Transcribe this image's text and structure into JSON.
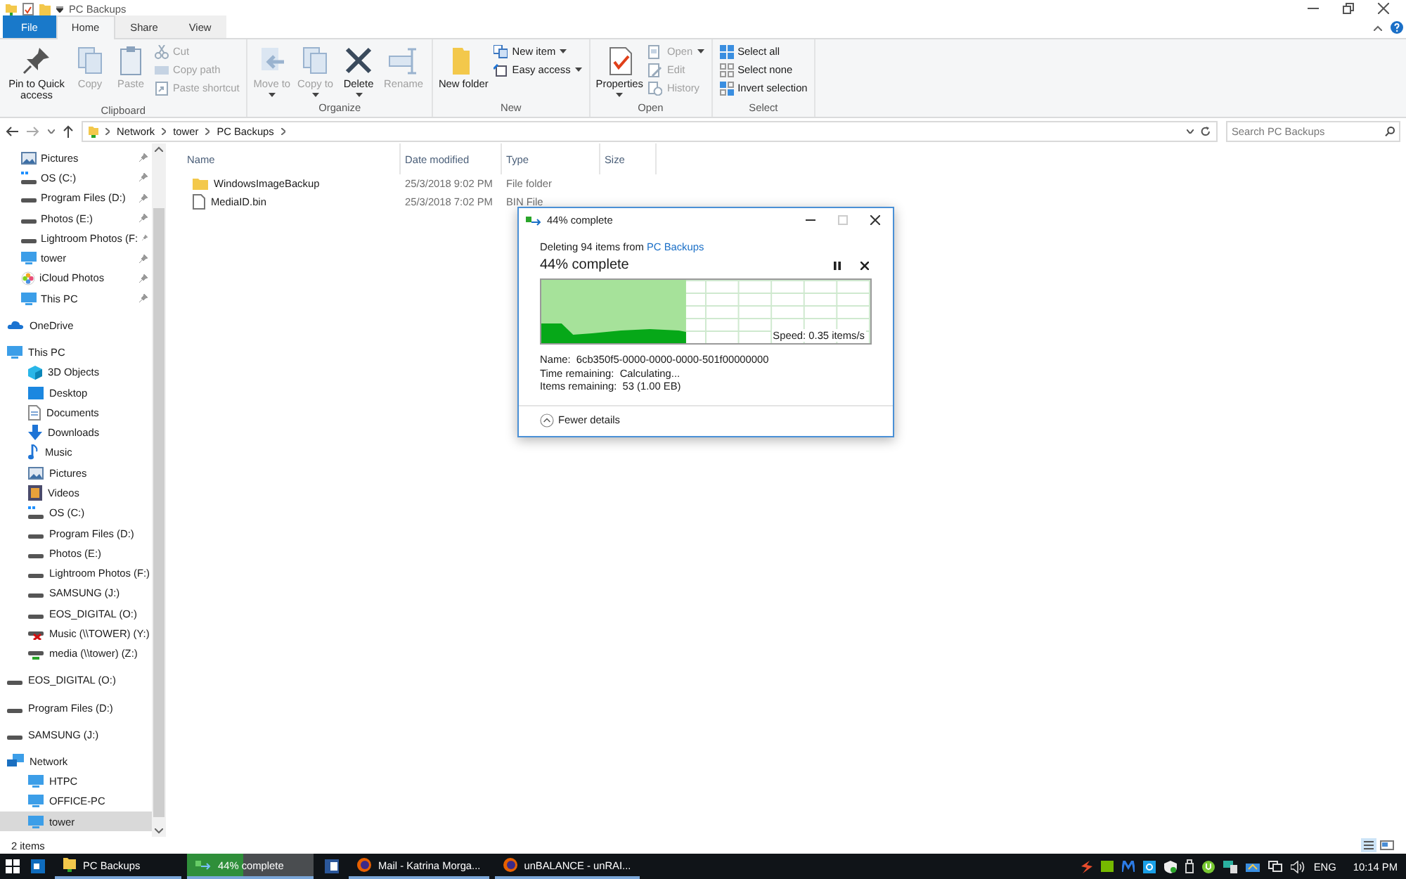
{
  "window": {
    "title": "PC Backups"
  },
  "ribbon_tabs": [
    {
      "label": "File",
      "kind": "file",
      "selected": false
    },
    {
      "label": "Home",
      "kind": "tab",
      "selected": true
    },
    {
      "label": "Share",
      "kind": "tab",
      "selected": false
    },
    {
      "label": "View",
      "kind": "tab",
      "selected": false
    }
  ],
  "ribbon_groups": [
    {
      "label": "Clipboard",
      "buttons": [
        {
          "label": "Pin to Quick access",
          "kind": "pin",
          "disabled": false,
          "dropdown": false
        },
        {
          "label": "Copy",
          "kind": "copy",
          "disabled": true,
          "dropdown": false
        },
        {
          "label": "Paste",
          "kind": "paste",
          "disabled": true,
          "dropdown": false
        },
        {
          "kind": "stack",
          "items": [
            {
              "label": "Cut",
              "kind": "cut",
              "disabled": true,
              "dropdown": false
            },
            {
              "label": "Copy path",
              "kind": "copy-path",
              "disabled": true,
              "dropdown": false
            },
            {
              "label": "Paste shortcut",
              "kind": "paste-shortcut",
              "disabled": true,
              "dropdown": false
            }
          ]
        }
      ]
    },
    {
      "label": "Organize",
      "buttons": [
        {
          "label": "Move to",
          "kind": "move",
          "disabled": true,
          "dropdown": true
        },
        {
          "label": "Copy to",
          "kind": "copyto",
          "disabled": true,
          "dropdown": true
        },
        {
          "label": "Delete",
          "kind": "delete",
          "disabled": false,
          "dropdown": true
        },
        {
          "label": "Rename",
          "kind": "rename",
          "disabled": true,
          "dropdown": false
        }
      ]
    },
    {
      "label": "New",
      "buttons": [
        {
          "label": "New folder",
          "kind": "new-folder",
          "disabled": false,
          "dropdown": false
        },
        {
          "kind": "stack",
          "items": [
            {
              "label": "New item",
              "kind": "new-item",
              "disabled": false,
              "dropdown": true
            },
            {
              "label": "Easy access",
              "kind": "easy-access",
              "disabled": false,
              "dropdown": true
            }
          ]
        }
      ]
    },
    {
      "label": "Open",
      "buttons": [
        {
          "label": "Properties",
          "kind": "properties",
          "disabled": false,
          "dropdown": true
        },
        {
          "kind": "stack",
          "items": [
            {
              "label": "Open",
              "kind": "open",
              "disabled": true,
              "dropdown": true
            },
            {
              "label": "Edit",
              "kind": "edit",
              "disabled": true,
              "dropdown": false
            },
            {
              "label": "History",
              "kind": "history",
              "disabled": true,
              "dropdown": false
            }
          ]
        }
      ]
    },
    {
      "label": "Select",
      "buttons": [
        {
          "kind": "stack",
          "items": [
            {
              "label": "Select all",
              "kind": "select-all",
              "disabled": false,
              "dropdown": false
            },
            {
              "label": "Select none",
              "kind": "select-none",
              "disabled": false,
              "dropdown": false
            },
            {
              "label": "Invert selection",
              "kind": "invert",
              "disabled": false,
              "dropdown": false
            }
          ]
        }
      ]
    }
  ],
  "address_bar": {
    "path": [
      "Network",
      "tower",
      "PC Backups"
    ]
  },
  "search": {
    "placeholder": "Search PC Backups"
  },
  "sidebar": {
    "quick_access_items": [
      {
        "label": "Pictures",
        "kind": "pictures",
        "pinned": true
      },
      {
        "label": "OS (C:)",
        "kind": "os-drive",
        "pinned": true
      },
      {
        "label": "Program Files (D:)",
        "kind": "drive",
        "pinned": true
      },
      {
        "label": "Photos (E:)",
        "kind": "drive",
        "pinned": true
      },
      {
        "label": "Lightroom Photos (F:",
        "kind": "drive",
        "pinned": true
      },
      {
        "label": "tower",
        "kind": "pc",
        "pinned": true
      },
      {
        "label": "iCloud Photos",
        "kind": "icloud",
        "pinned": true
      },
      {
        "label": "This PC",
        "kind": "pc",
        "pinned": true
      }
    ],
    "items": [
      {
        "label": "OneDrive",
        "kind": "cloud",
        "selected": false
      },
      {
        "label": "This PC",
        "kind": "pc",
        "selected": false,
        "children": [
          {
            "label": "3D Objects",
            "kind": "cube",
            "selected": false
          },
          {
            "label": "Desktop",
            "kind": "desktop",
            "selected": false
          },
          {
            "label": "Documents",
            "kind": "documents",
            "selected": false
          },
          {
            "label": "Downloads",
            "kind": "downloads",
            "selected": false
          },
          {
            "label": "Music",
            "kind": "music",
            "selected": false
          },
          {
            "label": "Pictures",
            "kind": "pictures",
            "selected": false
          },
          {
            "label": "Videos",
            "kind": "videos",
            "selected": false
          },
          {
            "label": "OS (C:)",
            "kind": "os-drive",
            "selected": false
          },
          {
            "label": "Program Files (D:)",
            "kind": "drive",
            "selected": false
          },
          {
            "label": "Photos (E:)",
            "kind": "drive",
            "selected": false
          },
          {
            "label": "Lightroom Photos (F:)",
            "kind": "drive",
            "selected": false
          },
          {
            "label": "SAMSUNG (J:)",
            "kind": "drive",
            "selected": false
          },
          {
            "label": "EOS_DIGITAL (O:)",
            "kind": "drive",
            "selected": false
          },
          {
            "label": "Music (\\\\TOWER) (Y:)",
            "kind": "net-drive-error",
            "selected": false
          },
          {
            "label": "media (\\\\tower) (Z:)",
            "kind": "net-drive",
            "selected": false
          }
        ]
      },
      {
        "label": "EOS_DIGITAL (O:)",
        "kind": "drive",
        "selected": false
      },
      {
        "label": "Program Files (D:)",
        "kind": "drive",
        "selected": false
      },
      {
        "label": "SAMSUNG (J:)",
        "kind": "drive",
        "selected": false
      },
      {
        "label": "Network",
        "kind": "network",
        "selected": false,
        "children": [
          {
            "label": "HTPC",
            "kind": "pc",
            "selected": false
          },
          {
            "label": "OFFICE-PC",
            "kind": "pc",
            "selected": false
          },
          {
            "label": "tower",
            "kind": "pc",
            "selected": true
          }
        ]
      }
    ]
  },
  "file_list": {
    "columns": [
      "Name",
      "Date modified",
      "Type",
      "Size"
    ],
    "rows": [
      {
        "name": "WindowsImageBackup",
        "kind": "folder",
        "date": "25/3/2018 9:02 PM",
        "type": "File folder"
      },
      {
        "name": "MediaID.bin",
        "kind": "file",
        "date": "25/3/2018 7:02 PM",
        "type": "BIN File"
      }
    ]
  },
  "status_bar": {
    "item_count": "2 items"
  },
  "progress_dialog": {
    "title": "44% complete",
    "message_prefix": "Deleting 94 items from ",
    "message_link": "PC Backups",
    "heading": "44% complete",
    "level": 0.44,
    "speed": "Speed: 0.35 items/s",
    "details": [
      {
        "label": "Name:",
        "value": "6cb350f5-0000-0000-0000-501f00000000"
      },
      {
        "label": "Time remaining:",
        "value": "Calculating..."
      },
      {
        "label": "Items remaining:",
        "value": "53 (1.00 EB)"
      }
    ],
    "toggle": "Fewer details"
  },
  "taskbar": {
    "items": [
      {
        "label": "PC Backups",
        "kind": "explorer",
        "running": true,
        "selected": false
      },
      {
        "label": "44% complete",
        "kind": "progress",
        "running": true,
        "selected": true,
        "level": 0.44
      },
      {
        "label": "Mail - Katrina Morga...",
        "kind": "firefox",
        "running": true,
        "selected": false
      },
      {
        "label": "unBALANCE - unRAI...",
        "kind": "firefox",
        "running": true,
        "selected": false
      }
    ],
    "language": "ENG",
    "time": "10:14 PM"
  }
}
